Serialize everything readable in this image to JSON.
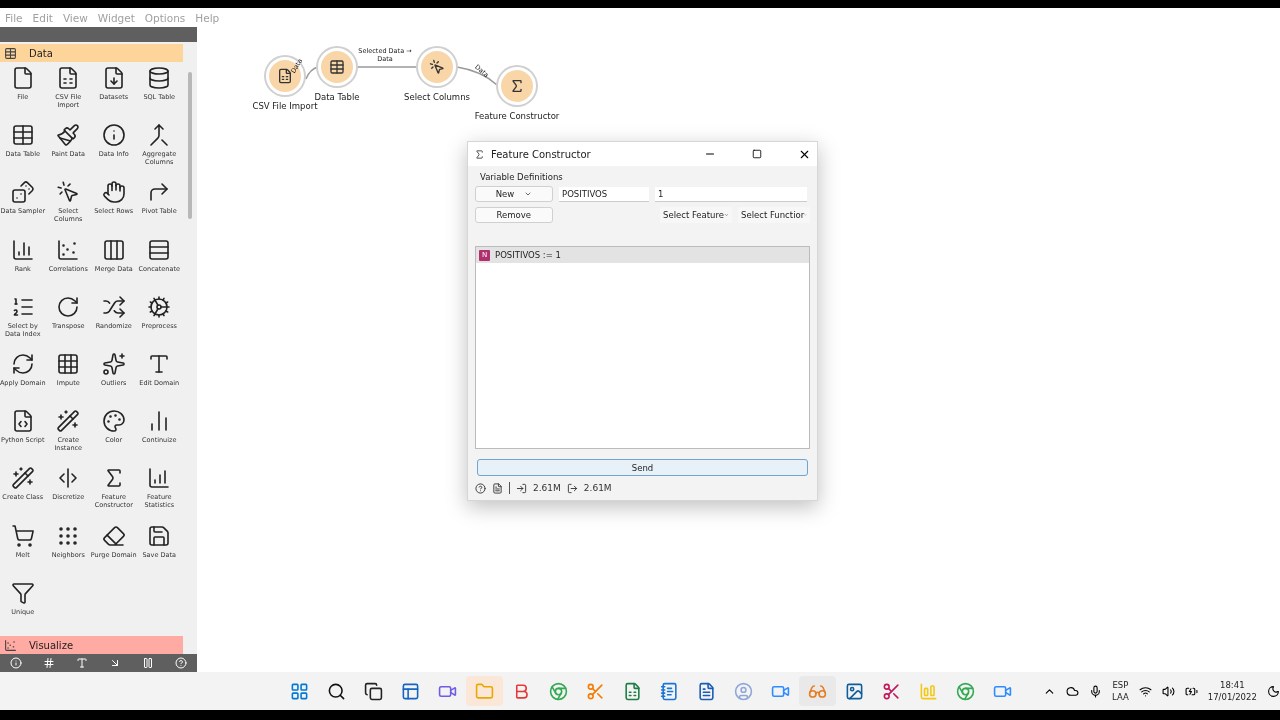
{
  "menu_bar": [
    "File",
    "Edit",
    "View",
    "Widget",
    "Options",
    "Help"
  ],
  "sidebar": {
    "categories": [
      {
        "title": "Data",
        "color": "#fdd49a",
        "expanded": true,
        "widgets": [
          "File",
          "CSV File Import",
          "Datasets",
          "SQL Table",
          "Data Table",
          "Paint Data",
          "Data Info",
          "Aggregate Columns",
          "Data Sampler",
          "Select Columns",
          "Select Rows",
          "Pivot Table",
          "Rank",
          "Correlations",
          "Merge Data",
          "Concatenate",
          "Select by Data Index",
          "Transpose",
          "Randomize",
          "Preprocess",
          "Apply Domain",
          "Impute",
          "Outliers",
          "Edit Domain",
          "Python Script",
          "Create Instance",
          "Color",
          "Continuize",
          "Create Class",
          "Discretize",
          "Feature Constructor",
          "Feature Statistics",
          "Melt",
          "Neighbors",
          "Purge Domain",
          "Save Data",
          "Unique"
        ]
      },
      {
        "title": "Visualize",
        "color": "#ffaaa2",
        "expanded": false
      }
    ]
  },
  "canvas": {
    "nodes": [
      {
        "label": "CSV File Import"
      },
      {
        "label": "Data Table"
      },
      {
        "label": "Select Columns"
      },
      {
        "label": "Feature Constructor"
      }
    ],
    "links": [
      {
        "label": "Data"
      },
      {
        "label": "Selected Data → Data"
      },
      {
        "label": "Data"
      }
    ]
  },
  "dialog": {
    "title": "Feature Constructor",
    "section": "Variable Definitions",
    "new_button": "New",
    "remove_button": "Remove",
    "name_value": "POSITIVOS",
    "expression_value": "1",
    "feature_select": "Select Feature",
    "function_select": "Select Functior",
    "definitions": [
      {
        "badge": "N",
        "text": "POSITIVOS := 1",
        "selected": true
      }
    ],
    "send_button": "Send",
    "input_size": "2.61M",
    "output_size": "2.61M"
  },
  "taskbar": {
    "language": "ESP",
    "layout": "LAA",
    "time": "18:41",
    "date": "17/01/2022"
  }
}
